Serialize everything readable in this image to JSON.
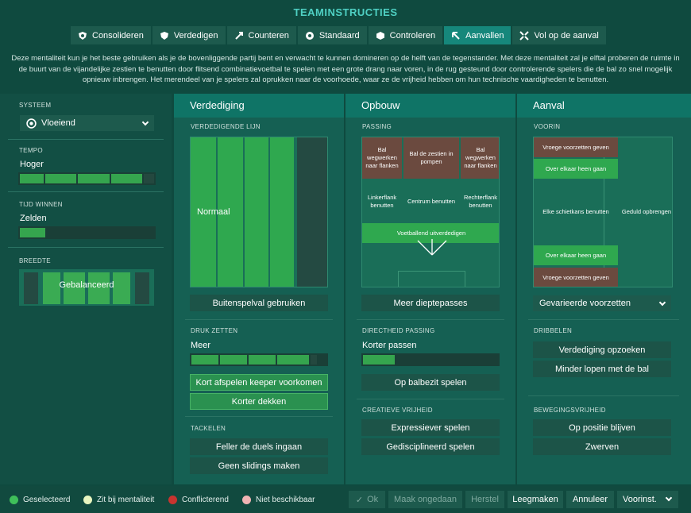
{
  "title": "TEAMINSTRUCTIES",
  "tabs": [
    {
      "label": "Consolideren",
      "icon": "shield-heart-icon"
    },
    {
      "label": "Verdedigen",
      "icon": "shield-icon"
    },
    {
      "label": "Counteren",
      "icon": "arrows-icon"
    },
    {
      "label": "Standaard",
      "icon": "circle-icon"
    },
    {
      "label": "Controleren",
      "icon": "cube-icon"
    },
    {
      "label": "Aanvallen",
      "icon": "attack-arrow-icon",
      "active": true
    },
    {
      "label": "Vol op de aanval",
      "icon": "multi-arrow-icon"
    }
  ],
  "description": "Deze mentaliteit kun je het beste gebruiken als je de bovenliggende partij bent en verwacht te kunnen domineren op de helft van de tegenstander. Met deze mentaliteit zal je elftal proberen de ruimte in de buurt van de vijandelijke zestien te benutten door flitsend combinatievoetbal te spelen met een grote drang naar voren, in de rug gesteund door controlerende spelers die de bal zo snel mogelijk opnieuw inbrengen. Het merendeel van je spelers zal oprukken naar de voorhoede, waar ze de vrijheid hebben om hun technische vaardigheden te benutten.",
  "left": {
    "system_label": "SYSTEEM",
    "system_value": "Vloeiend",
    "tempo_label": "TEMPO",
    "tempo_value": "Hoger",
    "tempo_level": 0.8,
    "time_label": "TIJD WINNEN",
    "time_value": "Zelden",
    "time_level": 0.2,
    "width_label": "BREEDTE",
    "width_value": "Gebalanceerd"
  },
  "defence": {
    "head": "Verdediging",
    "line_label": "VERDEDIGENDE LIJN",
    "line_value": "Normaal",
    "offside_button": "Buitenspelval gebruiken",
    "press_label": "DRUK ZETTEN",
    "press_value": "Meer",
    "press_level": 0.8,
    "keeper_button": "Kort afspelen keeper voorkomen",
    "mark_button": "Korter dekken",
    "tackle_label": "TACKELEN",
    "tackle_btn1": "Feller de duels ingaan",
    "tackle_btn2": "Geen slidings maken"
  },
  "build": {
    "head": "Opbouw",
    "passing_label": "PASSING",
    "z1": "Bal wegwerken naar flanken",
    "z2": "Bal de zestien in pompen",
    "z3": "Bal wegwerken naar flanken",
    "z4": "Linkerflank benutten",
    "z5": "Centrum benutten",
    "z6": "Rechterflank benutten",
    "z7": "Voetballend uitverdedigen",
    "depth_button": "Meer dieptepasses",
    "directness_label": "DIRECTHEID PASSING",
    "directness_value": "Korter passen",
    "directness_level": 0.25,
    "possession_button": "Op balbezit spelen",
    "creative_label": "CREATIEVE VRIJHEID",
    "creative_btn1": "Expressiever spelen",
    "creative_btn2": "Gedisciplineerd spelen"
  },
  "attack": {
    "head": "Aanval",
    "forward_label": "VOORIN",
    "a1": "Vroege voorzetten geven",
    "a2": "Over elkaar heen gaan",
    "a3": "Elke schietkans benutten",
    "a4": "Geduld opbrengen",
    "a5": "Over elkaar heen gaan",
    "a6": "Vroege voorzetten geven",
    "cross_select": "Gevarieerde voorzetten",
    "dribble_label": "DRIBBELEN",
    "dribble_btn1": "Verdediging opzoeken",
    "dribble_btn2": "Minder lopen met de bal",
    "movement_label": "BEWEGINGSVRIJHEID",
    "movement_btn1": "Op positie blijven",
    "movement_btn2": "Zwerven"
  },
  "legend": {
    "selected": "Geselecteerd",
    "fits": "Zit bij mentaliteit",
    "conflict": "Conflicterend",
    "unavailable": "Niet beschikbaar",
    "colors": {
      "selected": "#3fbf5a",
      "fits": "#e8f5c0",
      "conflict": "#c8342f",
      "unavailable": "#f0b4b4"
    }
  },
  "footer": {
    "ok": "Ok",
    "undo": "Maak ongedaan",
    "reset": "Herstel",
    "clear": "Leegmaken",
    "cancel": "Annuleer",
    "presets": "Voorinst."
  }
}
